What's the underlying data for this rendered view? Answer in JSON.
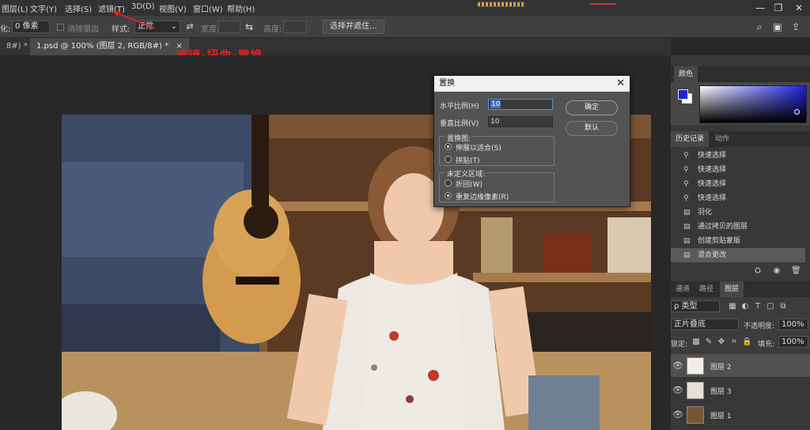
{
  "menu": [
    "图层(L)",
    "文字(Y)",
    "选择(S)",
    "滤镜(T)",
    "3D(D)",
    "视图(V)",
    "窗口(W)",
    "帮助(H)"
  ],
  "options": {
    "feather_label": "化:",
    "feather_value": "0 像素",
    "antialias_label": "消除锯齿",
    "style_label": "样式:",
    "style_value": "正常",
    "width_label": "宽度:",
    "height_label": "高度:",
    "select_mask_button": "选择并遮住..."
  },
  "tabs": {
    "prev_tab": "8#) *",
    "active_tab": "1.psd @ 100% (图层 2, RGB/8#) *"
  },
  "annotation": "滤镜-扭曲-置换",
  "dialog": {
    "title": "置换",
    "horizontal_label": "水平比例(H)",
    "horizontal_value": "10",
    "vertical_label": "垂直比例(V)",
    "vertical_value": "10",
    "ok_button": "确定",
    "reset_button": "默认",
    "map_group_label": "置换图:",
    "map_options": [
      "伸展以适合(S)",
      "拼贴(T)"
    ],
    "map_selected": 0,
    "undefined_group_label": "未定义区域:",
    "undefined_options": [
      "折回(W)",
      "重复边缘像素(R)"
    ],
    "undefined_selected": 1
  },
  "color_panel": {
    "title": "颜色",
    "foreground": "#1f26c8",
    "background": "#ffffff",
    "spectrum_hue": "#1a20e6"
  },
  "history_panel": {
    "tabs": [
      "历史记录",
      "动作"
    ],
    "items": [
      "快速选择",
      "快速选择",
      "快速选择",
      "快速选择",
      "羽化",
      "通过拷贝的图层",
      "创建剪贴蒙版",
      "混合更改"
    ],
    "selected_index": 7
  },
  "layers_panel": {
    "tabs": [
      "通道",
      "路径",
      "图层"
    ],
    "filter_label": "ρ 类型",
    "blend_mode": "正片叠底",
    "opacity_label": "不透明度:",
    "opacity_value": "100%",
    "lock_label": "锁定:",
    "fill_label": "填充:",
    "fill_value": "100%",
    "layers": [
      "图层 2",
      "图层 3",
      "图层 1"
    ]
  }
}
